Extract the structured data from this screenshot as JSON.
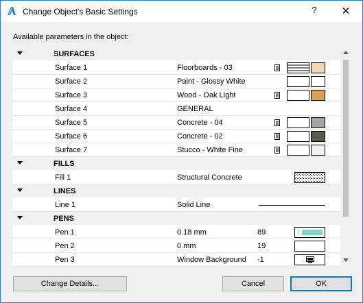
{
  "window": {
    "title": "Change Object's Basic Settings",
    "help_label": "?",
    "close_label": "✕"
  },
  "subtitle": "Available parameters in the object:",
  "colors": {
    "accent": "#0078d7",
    "window_border": "#1883d7",
    "pen_color": "#7fd6c5"
  },
  "groups": {
    "surfaces": {
      "label": "SURFACES",
      "items": [
        {
          "name": "Surface 1",
          "value": "Floorboards - 03",
          "swatch_color": "#efd9b4",
          "pattern": "horizontal-lines",
          "has_icon": true
        },
        {
          "name": "Surface 2",
          "value": "Paint - Glossy White",
          "swatch_color": "#ffffff",
          "pattern": "none",
          "has_icon": false
        },
        {
          "name": "Surface 3",
          "value": "Wood - Oak Light",
          "swatch_color": "#d9a44f",
          "pattern": "none",
          "has_icon": true
        },
        {
          "name": "Surface 4",
          "value": "GENERAL"
        },
        {
          "name": "Surface 5",
          "value": "Concrete - 04",
          "swatch_color": "#a3a69c",
          "pattern": "none",
          "has_icon": true
        },
        {
          "name": "Surface 6",
          "value": "Concrete - 02",
          "swatch_color": "#575d4a",
          "pattern": "none",
          "has_icon": true
        },
        {
          "name": "Surface 7",
          "value": "Stucco - White Fine",
          "swatch_color": "#f2f2ee",
          "pattern": "none",
          "has_icon": true
        }
      ]
    },
    "fills": {
      "label": "FILLS",
      "items": [
        {
          "name": "Fill 1",
          "value": "Structural Concrete",
          "pattern": "concrete-dots"
        }
      ]
    },
    "lines": {
      "label": "LINES",
      "items": [
        {
          "name": "Line 1",
          "value": "Solid Line",
          "pattern": "solid-line"
        }
      ]
    },
    "pens": {
      "label": "PENS",
      "items": [
        {
          "name": "Pen 1",
          "value": "0.18 mm",
          "number": "89",
          "swatch": "pen-color"
        },
        {
          "name": "Pen 2",
          "value": "0 mm",
          "number": "19",
          "swatch": "empty"
        },
        {
          "name": "Pen 3",
          "value": "Window Background",
          "number": "-1",
          "swatch": "monitor-icon"
        }
      ]
    }
  },
  "buttons": {
    "change_details": "Change Details...",
    "cancel": "Cancel",
    "ok": "OK"
  }
}
